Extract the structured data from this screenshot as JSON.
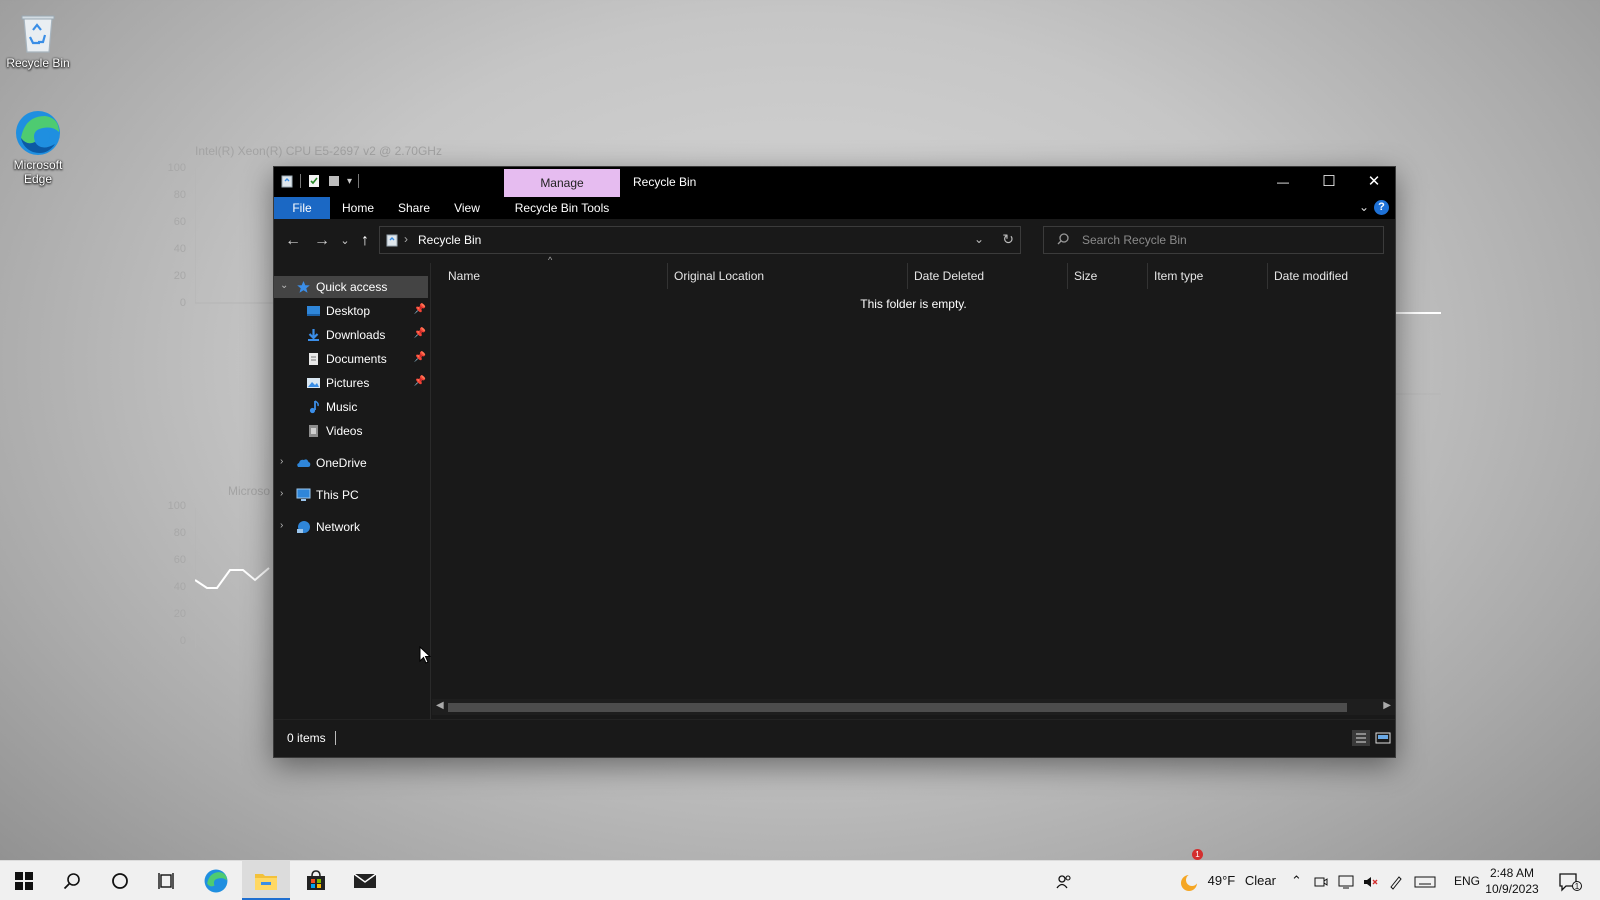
{
  "desktop": {
    "icons": [
      {
        "label": "Recycle Bin",
        "icon": "recycle-bin-icon"
      },
      {
        "label": "Microsoft Edge",
        "icon": "edge-icon"
      }
    ],
    "bg_widget_top": {
      "title": "Intel(R) Xeon(R) CPU E5-2697 v2 @ 2.70GHz",
      "ticks": [
        "100",
        "80",
        "60",
        "40",
        "20",
        "0"
      ]
    },
    "bg_widget_bottom": {
      "title": "Microso",
      "ticks": [
        "100",
        "80",
        "60",
        "40",
        "20",
        "0"
      ]
    }
  },
  "window": {
    "title": "Recycle Bin",
    "context_tab": "Manage",
    "controls": {
      "minimize": "—",
      "maximize": "☐",
      "close": "✕"
    },
    "ribbon_tabs": [
      "File",
      "Home",
      "Share",
      "View",
      "Recycle Bin Tools"
    ],
    "help": "?",
    "address": {
      "separator": "›",
      "path": "Recycle Bin"
    },
    "search": {
      "placeholder": "Search Recycle Bin"
    },
    "nav": {
      "quick_access": "Quick access",
      "pinned": [
        {
          "label": "Desktop",
          "icon": "desktop-folder-icon",
          "pinned": true
        },
        {
          "label": "Downloads",
          "icon": "downloads-folder-icon",
          "pinned": true
        },
        {
          "label": "Documents",
          "icon": "documents-folder-icon",
          "pinned": true
        },
        {
          "label": "Pictures",
          "icon": "pictures-folder-icon",
          "pinned": true
        },
        {
          "label": "Music",
          "icon": "music-folder-icon",
          "pinned": false
        },
        {
          "label": "Videos",
          "icon": "videos-folder-icon",
          "pinned": false
        }
      ],
      "roots": [
        {
          "label": "OneDrive",
          "icon": "onedrive-icon"
        },
        {
          "label": "This PC",
          "icon": "this-pc-icon"
        },
        {
          "label": "Network",
          "icon": "network-icon"
        }
      ]
    },
    "columns": [
      "Name",
      "Original Location",
      "Date Deleted",
      "Size",
      "Item type",
      "Date modified"
    ],
    "empty_message": "This folder is empty.",
    "status": {
      "items": "0 items"
    }
  },
  "taskbar": {
    "apps": [
      "start-icon",
      "search-icon",
      "cortana-icon",
      "task-view-icon",
      "edge-icon",
      "file-explorer-icon",
      "store-icon",
      "mail-icon"
    ],
    "active_app": "file-explorer-icon",
    "weather": {
      "temp": "49°F",
      "condition": "Clear",
      "badge": "1"
    },
    "lang": "ENG",
    "time": "2:48 AM",
    "date": "10/9/2023",
    "notification_count": "1"
  },
  "colors": {
    "accent": "#1b68c4",
    "manage_tab": "#e6bcf0",
    "window_bg": "#191919",
    "titlebar_bg": "#000000",
    "taskbar_bg": "#f0f0f0"
  }
}
